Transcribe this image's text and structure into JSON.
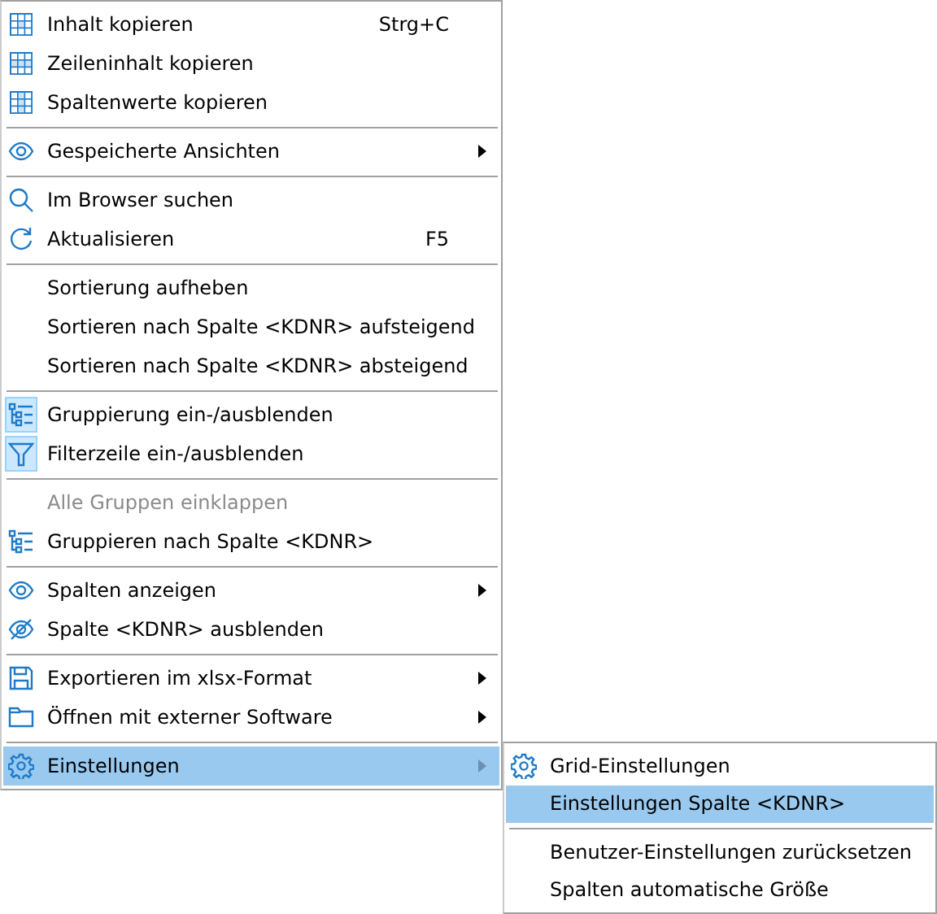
{
  "menu": {
    "groups": [
      [
        {
          "kind": "table",
          "label": "Inhalt kopieren",
          "shortcut": "Strg+C",
          "submenu": false,
          "checked": false,
          "disabled": false,
          "selected": false
        },
        {
          "kind": "rows",
          "label": "Zeileninhalt kopieren",
          "submenu": false,
          "checked": false,
          "disabled": false,
          "selected": false
        },
        {
          "kind": "columns",
          "label": "Spaltenwerte kopieren",
          "submenu": false,
          "checked": false,
          "disabled": false,
          "selected": false
        }
      ],
      [
        {
          "kind": "eye",
          "label": "Gespeicherte Ansichten",
          "submenu": true,
          "checked": false,
          "disabled": false,
          "selected": false
        }
      ],
      [
        {
          "kind": "search",
          "label": "Im Browser suchen",
          "submenu": false,
          "checked": false,
          "disabled": false,
          "selected": false
        },
        {
          "kind": "refresh",
          "label": "Aktualisieren",
          "shortcut": "F5",
          "submenu": false,
          "checked": false,
          "disabled": false,
          "selected": false
        }
      ],
      [
        {
          "kind": "plain",
          "label": "Sortierung aufheben",
          "submenu": false,
          "checked": false,
          "disabled": false,
          "selected": false
        },
        {
          "kind": "plain",
          "label": "Sortieren nach Spalte <KDNR> aufsteigend",
          "submenu": false,
          "checked": false,
          "disabled": false,
          "selected": false
        },
        {
          "kind": "plain",
          "label": "Sortieren nach Spalte <KDNR> absteigend",
          "submenu": false,
          "checked": false,
          "disabled": false,
          "selected": false
        }
      ],
      [
        {
          "kind": "tree",
          "label": "Gruppierung ein-/ausblenden",
          "submenu": false,
          "checked": true,
          "disabled": false,
          "selected": false
        },
        {
          "kind": "filter",
          "label": "Filterzeile ein-/ausblenden",
          "submenu": false,
          "checked": true,
          "disabled": false,
          "selected": false
        }
      ],
      [
        {
          "kind": "plain",
          "label": "Alle Gruppen einklappen",
          "submenu": false,
          "checked": false,
          "disabled": true,
          "selected": false
        },
        {
          "kind": "tree",
          "label": "Gruppieren nach Spalte <KDNR>",
          "submenu": false,
          "checked": false,
          "disabled": false,
          "selected": false
        }
      ],
      [
        {
          "kind": "eye",
          "label": "Spalten anzeigen",
          "submenu": true,
          "checked": false,
          "disabled": false,
          "selected": false
        },
        {
          "kind": "eyeoff",
          "label": "Spalte <KDNR> ausblenden",
          "submenu": false,
          "checked": false,
          "disabled": false,
          "selected": false
        }
      ],
      [
        {
          "kind": "save",
          "label": "Exportieren im xlsx-Format",
          "submenu": true,
          "checked": false,
          "disabled": false,
          "selected": false
        },
        {
          "kind": "folder",
          "label": "Öffnen mit externer Software",
          "submenu": true,
          "checked": false,
          "disabled": false,
          "selected": false
        }
      ],
      [
        {
          "kind": "gear",
          "label": "Einstellungen",
          "submenu": true,
          "checked": false,
          "disabled": false,
          "selected": true
        }
      ]
    ]
  },
  "submenu": {
    "groups": [
      [
        {
          "kind": "gear",
          "label": "Grid-Einstellungen",
          "selected": false
        },
        {
          "kind": "plain",
          "label": "Einstellungen Spalte <KDNR>",
          "selected": true
        }
      ],
      [
        {
          "kind": "plain",
          "label": "Benutzer-Einstellungen zurücksetzen",
          "selected": false
        },
        {
          "kind": "plain",
          "label": "Spalten automatische Größe",
          "selected": false
        }
      ]
    ]
  }
}
